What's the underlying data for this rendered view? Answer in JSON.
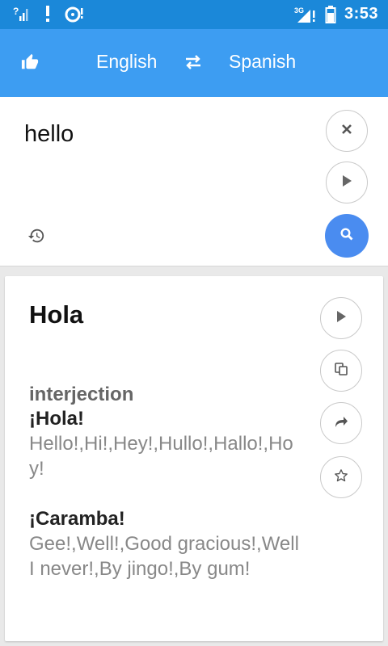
{
  "status_bar": {
    "time": "3:53",
    "network_type": "3G",
    "icons": [
      "signal-unknown-icon",
      "alert-icon",
      "disk-alert-icon",
      "signal-3g-icon",
      "battery-icon"
    ]
  },
  "app_bar": {
    "source_language": "English",
    "target_language": "Spanish",
    "icons": [
      "thumbs-up-icon",
      "swap-icon"
    ]
  },
  "input": {
    "text": "hello",
    "icons": [
      "close-icon",
      "play-icon",
      "history-icon",
      "search-icon"
    ],
    "search_color": "#4a8cf0"
  },
  "result": {
    "title": "Hola",
    "entries": [
      {
        "part_of_speech": "interjection",
        "headword": "¡Hola!",
        "meanings": "Hello!,Hi!,Hey!,Hullo!,Hallo!,Hoy!"
      },
      {
        "headword": "¡Caramba!",
        "meanings": "Gee!,Well!,Good gracious!,Well I never!,By jingo!,By gum!"
      }
    ],
    "actions": [
      "play-icon",
      "copy-icon",
      "share-icon",
      "star-icon"
    ]
  },
  "colors": {
    "status_bar": "#1b88d9",
    "app_bar": "#3d9df2",
    "accent": "#4a8cf0"
  }
}
